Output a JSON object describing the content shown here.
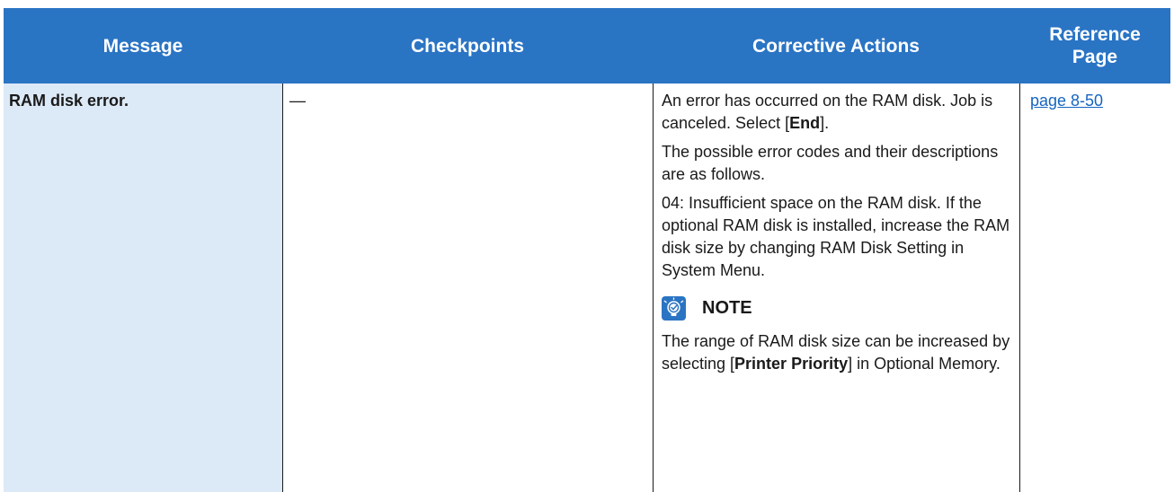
{
  "header": {
    "message": "Message",
    "checkpoints": "Checkpoints",
    "corrective_actions": "Corrective Actions",
    "reference_page_line1": "Reference",
    "reference_page_line2": "Page"
  },
  "row": {
    "message": "RAM disk error.",
    "checkpoints": "—",
    "actions": {
      "p1_before": "An error has occurred on the RAM disk. Job is canceled. Select [",
      "p1_bold": "End",
      "p1_after": "].",
      "p2": "The possible error codes and their descriptions are as follows.",
      "p3": "04: Insufficient space on the RAM disk. If the optional RAM disk is installed, increase the RAM disk size by changing RAM Disk Setting in System Menu.",
      "note_label": "NOTE",
      "note_before": "The range of RAM disk size can be increased by selecting [",
      "note_bold": "Printer Priority",
      "note_after": "] in Optional Memory."
    },
    "reference": "page 8-50"
  },
  "colors": {
    "header_bg": "#2a74c4",
    "message_col_bg": "#dce9f7",
    "link": "#1565c0"
  },
  "icons": {
    "note": "lightbulb-note-icon"
  }
}
